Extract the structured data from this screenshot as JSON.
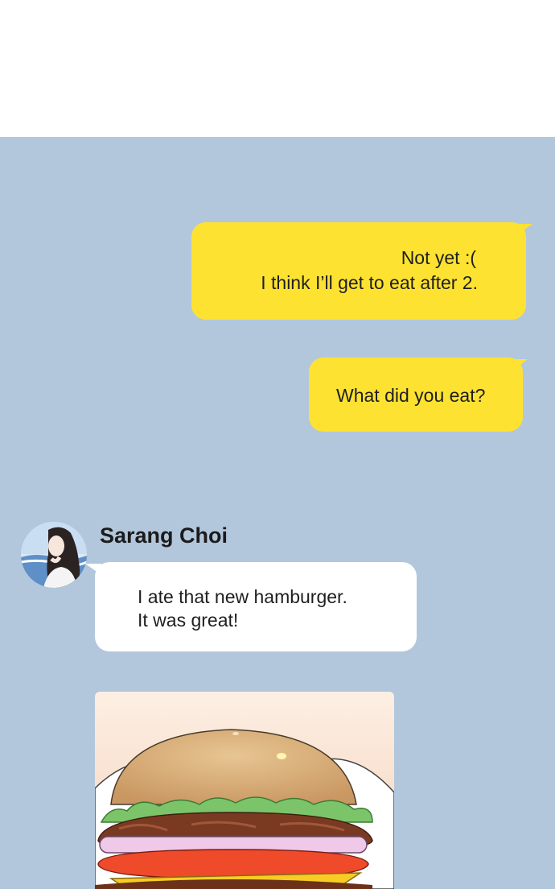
{
  "messages": [
    {
      "direction": "outgoing",
      "lines": [
        "Not yet :(",
        "I think I’ll get to eat after 2."
      ]
    },
    {
      "direction": "outgoing",
      "lines": [
        "What did you eat?"
      ]
    }
  ],
  "incoming": {
    "sender_name": "Sarang Choi",
    "lines": [
      "I ate that new hamburger.",
      "It was great!"
    ],
    "photo": "hamburger-photo"
  },
  "colors": {
    "chat_background": "#b2c7dc",
    "outgoing_bubble": "#fde232",
    "incoming_bubble": "#ffffff"
  }
}
